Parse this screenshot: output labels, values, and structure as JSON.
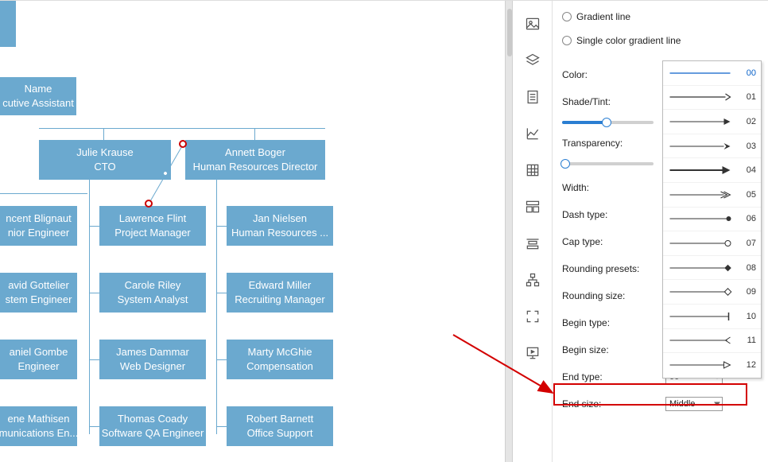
{
  "orgchart": {
    "partial_top": {
      "line1": "",
      "line2": ""
    },
    "cardA": {
      "line1": "Name",
      "line2": "cutive Assistant"
    },
    "julie": {
      "line1": "Julie Krause",
      "line2": "CTO"
    },
    "annett": {
      "line1": "Annett Boger",
      "line2": "Human Resources Director"
    },
    "vincent": {
      "line1": "ncent Blignaut",
      "line2": "nior Engineer"
    },
    "lawrence": {
      "line1": "Lawrence Flint",
      "line2": "Project Manager"
    },
    "jan": {
      "line1": "Jan Nielsen",
      "line2": "Human Resources ..."
    },
    "david": {
      "line1": "avid Gottelier",
      "line2": "stem Engineer"
    },
    "carole": {
      "line1": "Carole Riley",
      "line2": "System Analyst"
    },
    "edward": {
      "line1": "Edward Miller",
      "line2": "Recruiting Manager"
    },
    "daniel": {
      "line1": "aniel Gombe",
      "line2": "Engineer"
    },
    "james": {
      "line1": "James Dammar",
      "line2": "Web Designer"
    },
    "marty": {
      "line1": "Marty McGhie",
      "line2": "Compensation"
    },
    "ene": {
      "line1": "ene Mathisen",
      "line2": "munications En..."
    },
    "thomas": {
      "line1": "Thomas Coady",
      "line2": "Software QA Engineer"
    },
    "robert": {
      "line1": "Robert Barnett",
      "line2": "Office Support"
    }
  },
  "panel": {
    "radio_gradient": "Gradient line",
    "radio_single": "Single color gradient line",
    "color_label": "Color:",
    "shade_label": "Shade/Tint:",
    "transparency_label": "Transparency:",
    "width_label": "Width:",
    "dash_label": "Dash type:",
    "cap_label": "Cap type:",
    "roundpreset_label": "Rounding presets:",
    "roundsize_label": "Rounding size:",
    "begintype_label": "Begin type:",
    "beginsize_label": "Begin size:",
    "endtype_label": "End type:",
    "endtype_value": "00",
    "endsize_label": "End size:",
    "endsize_value": "Middle",
    "options": [
      {
        "id": "00"
      },
      {
        "id": "01"
      },
      {
        "id": "02"
      },
      {
        "id": "03"
      },
      {
        "id": "04"
      },
      {
        "id": "05"
      },
      {
        "id": "06"
      },
      {
        "id": "07"
      },
      {
        "id": "08"
      },
      {
        "id": "09"
      },
      {
        "id": "10"
      },
      {
        "id": "11"
      },
      {
        "id": "12"
      }
    ]
  },
  "rail_icons": [
    "picture",
    "layers",
    "document-lines",
    "chart",
    "calc-grid",
    "layout",
    "align",
    "hierarchy",
    "fullscreen",
    "presentation"
  ]
}
